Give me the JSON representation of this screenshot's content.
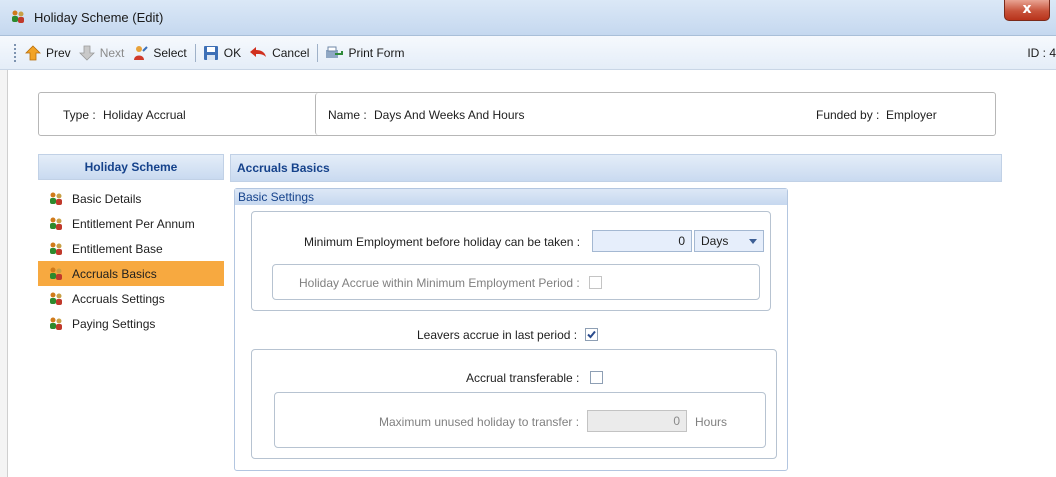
{
  "window": {
    "title": "Holiday Scheme (Edit)",
    "close_glyph": "x"
  },
  "toolbar": {
    "prev": "Prev",
    "next": "Next",
    "select": "Select",
    "ok": "OK",
    "cancel": "Cancel",
    "print": "Print Form",
    "id_label": "ID : 4"
  },
  "header": {
    "type_label": "Type :",
    "type_value": "Holiday Accrual",
    "name_label": "Name :",
    "name_value": "Days And Weeks And Hours",
    "funded_label": "Funded by :",
    "funded_value": "Employer"
  },
  "nav": {
    "title": "Holiday Scheme",
    "items": [
      {
        "label": "Basic Details",
        "active": false
      },
      {
        "label": "Entitlement Per Annum",
        "active": false
      },
      {
        "label": "Entitlement Base",
        "active": false
      },
      {
        "label": "Accruals Basics",
        "active": true
      },
      {
        "label": "Accruals Settings",
        "active": false
      },
      {
        "label": "Paying Settings",
        "active": false
      }
    ]
  },
  "content": {
    "title": "Accruals Basics",
    "section_title": "Basic Settings",
    "min_employment_label": "Minimum Employment before holiday can be taken :",
    "min_employment_value": "0",
    "min_employment_unit": "Days",
    "accrue_within_label": "Holiday Accrue within Minimum Employment Period :",
    "accrue_within_checked": false,
    "leavers_label": "Leavers accrue in last period :",
    "leavers_checked": true,
    "transferable_label": "Accrual transferable :",
    "transferable_checked": false,
    "max_unused_label": "Maximum unused holiday to transfer :",
    "max_unused_value": "0",
    "max_unused_unit": "Hours"
  },
  "colors": {
    "accent_header_text": "#15428b",
    "active_nav_bg": "#f7a940",
    "check_color": "#2a4b8d"
  }
}
